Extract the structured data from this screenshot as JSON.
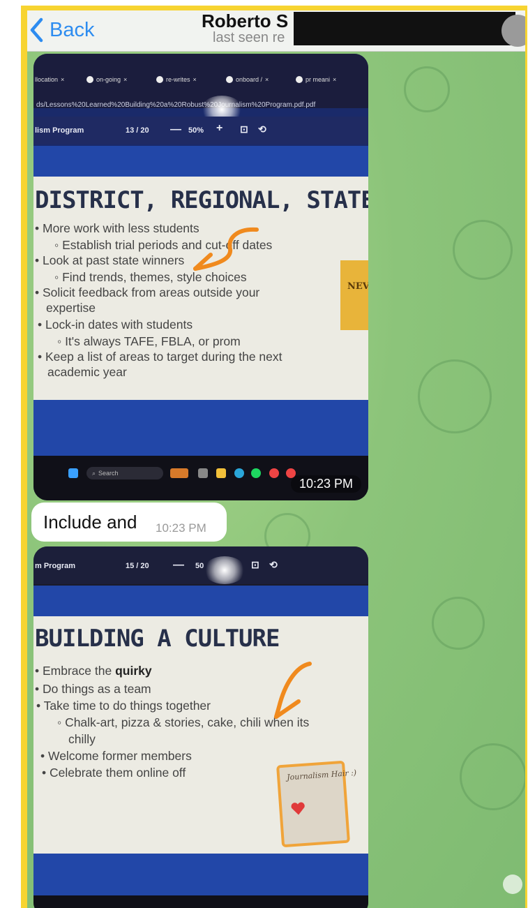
{
  "header": {
    "back_label": "Back",
    "contact_name": "Roberto S",
    "status": "last seen re"
  },
  "messages": [
    {
      "type": "photo",
      "browser_tabs": [
        "llocation",
        "on-going",
        "re-writes",
        "onboard /",
        "pr meani"
      ],
      "url": "ds/Lessons%20Learned%20Building%20a%20Robust%20Journalism%20Program.pdf.pdf",
      "pdf_title": "lism Program",
      "page": "13 / 20",
      "zoom": "50%",
      "slide_title": "DISTRICT, REGIONAL, STATE",
      "bullets": [
        "• More work with less students",
        "◦ Establish trial periods and cut-off dates",
        "• Look at past state winners",
        "◦ Find trends, themes, style choices",
        "• Solicit feedback from areas outside your",
        "expertise",
        "• Lock-in dates with students",
        "◦ It's always TAFE, FBLA, or prom",
        "• Keep a list of areas to target during the next",
        "academic year"
      ],
      "sticky_text": "NEV",
      "taskbar_search": "Search",
      "time": "10:23 PM"
    },
    {
      "type": "text",
      "text": "Include and",
      "time": "10:23 PM"
    },
    {
      "type": "photo",
      "pdf_title": "m Program",
      "page": "15 / 20",
      "zoom": "50",
      "slide_title": "BUILDING A CULTURE",
      "bullets": [
        "• Embrace the ",
        "• Do things as a team",
        "• Take time to do things together",
        "◦ Chalk-art, pizza & stories, cake, chili when its",
        "chilly",
        "• Welcome former members",
        "• Celebrate them online off"
      ],
      "bold_word": "quirky",
      "polaroid_label": "Journalism Hair :)"
    }
  ],
  "colors": {
    "frame": "#f7d431",
    "accent": "#2d8cf0",
    "annotation": "#f08a1e",
    "wallpaper": "#8cc47a"
  }
}
